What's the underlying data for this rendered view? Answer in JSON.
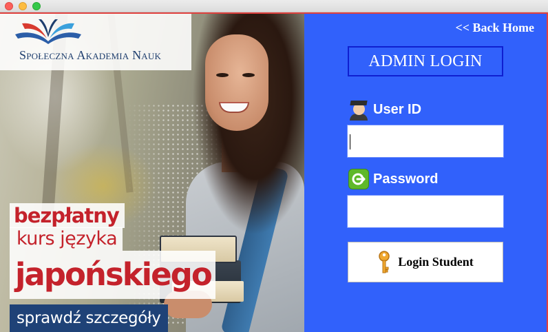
{
  "window": {
    "traffic_lights": [
      "close",
      "minimize",
      "maximize"
    ]
  },
  "advertisement": {
    "institution": "Społeczna Akademia Nauk",
    "promo_line1": "bezpłatny",
    "promo_line2": "kurs języka",
    "promo_line3": "japońskiego",
    "promo_cta": "sprawdź szczegóły"
  },
  "login": {
    "back_link": "<< Back Home",
    "title": "ADMIN LOGIN",
    "user_label": "User ID",
    "user_icon": "student-icon",
    "user_value": "",
    "password_label": "Password",
    "password_icon": "login-arrow-icon",
    "password_value": "",
    "button_label": "Login Student",
    "button_icon": "key-icon"
  },
  "colors": {
    "panel_background": "#3161fb",
    "title_border": "#0f1fd0",
    "promo_red": "#c4222b",
    "promo_navy": "#1f4277",
    "window_border": "#e0403d"
  }
}
